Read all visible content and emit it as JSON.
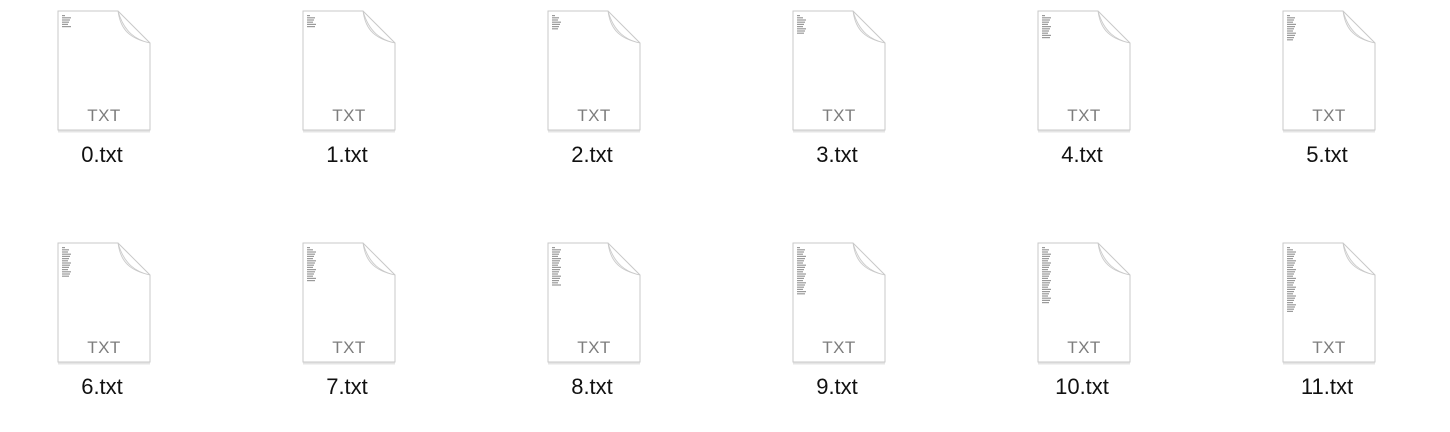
{
  "window": {
    "view": "icon-grid"
  },
  "colors": {
    "background": "#ffffff",
    "page": "#ffffff",
    "page_border": "#c9c9c9",
    "type_label": "#7d7d7d",
    "file_name": "#111111"
  },
  "files": [
    {
      "name": "0.txt",
      "type": "TXT",
      "icon": "text-document-icon",
      "preview_lines": 6
    },
    {
      "name": "1.txt",
      "type": "TXT",
      "icon": "text-document-icon",
      "preview_lines": 6
    },
    {
      "name": "2.txt",
      "type": "TXT",
      "icon": "text-document-icon",
      "preview_lines": 7
    },
    {
      "name": "3.txt",
      "type": "TXT",
      "icon": "text-document-icon",
      "preview_lines": 9
    },
    {
      "name": "4.txt",
      "type": "TXT",
      "icon": "text-document-icon",
      "preview_lines": 11
    },
    {
      "name": "5.txt",
      "type": "TXT",
      "icon": "text-document-icon",
      "preview_lines": 12
    },
    {
      "name": "6.txt",
      "type": "TXT",
      "icon": "text-document-icon",
      "preview_lines": 14
    },
    {
      "name": "7.txt",
      "type": "TXT",
      "icon": "text-document-icon",
      "preview_lines": 16
    },
    {
      "name": "8.txt",
      "type": "TXT",
      "icon": "text-document-icon",
      "preview_lines": 18
    },
    {
      "name": "9.txt",
      "type": "TXT",
      "icon": "text-document-icon",
      "preview_lines": 22
    },
    {
      "name": "10.txt",
      "type": "TXT",
      "icon": "text-document-icon",
      "preview_lines": 26
    },
    {
      "name": "11.txt",
      "type": "TXT",
      "icon": "text-document-icon",
      "preview_lines": 30
    }
  ]
}
